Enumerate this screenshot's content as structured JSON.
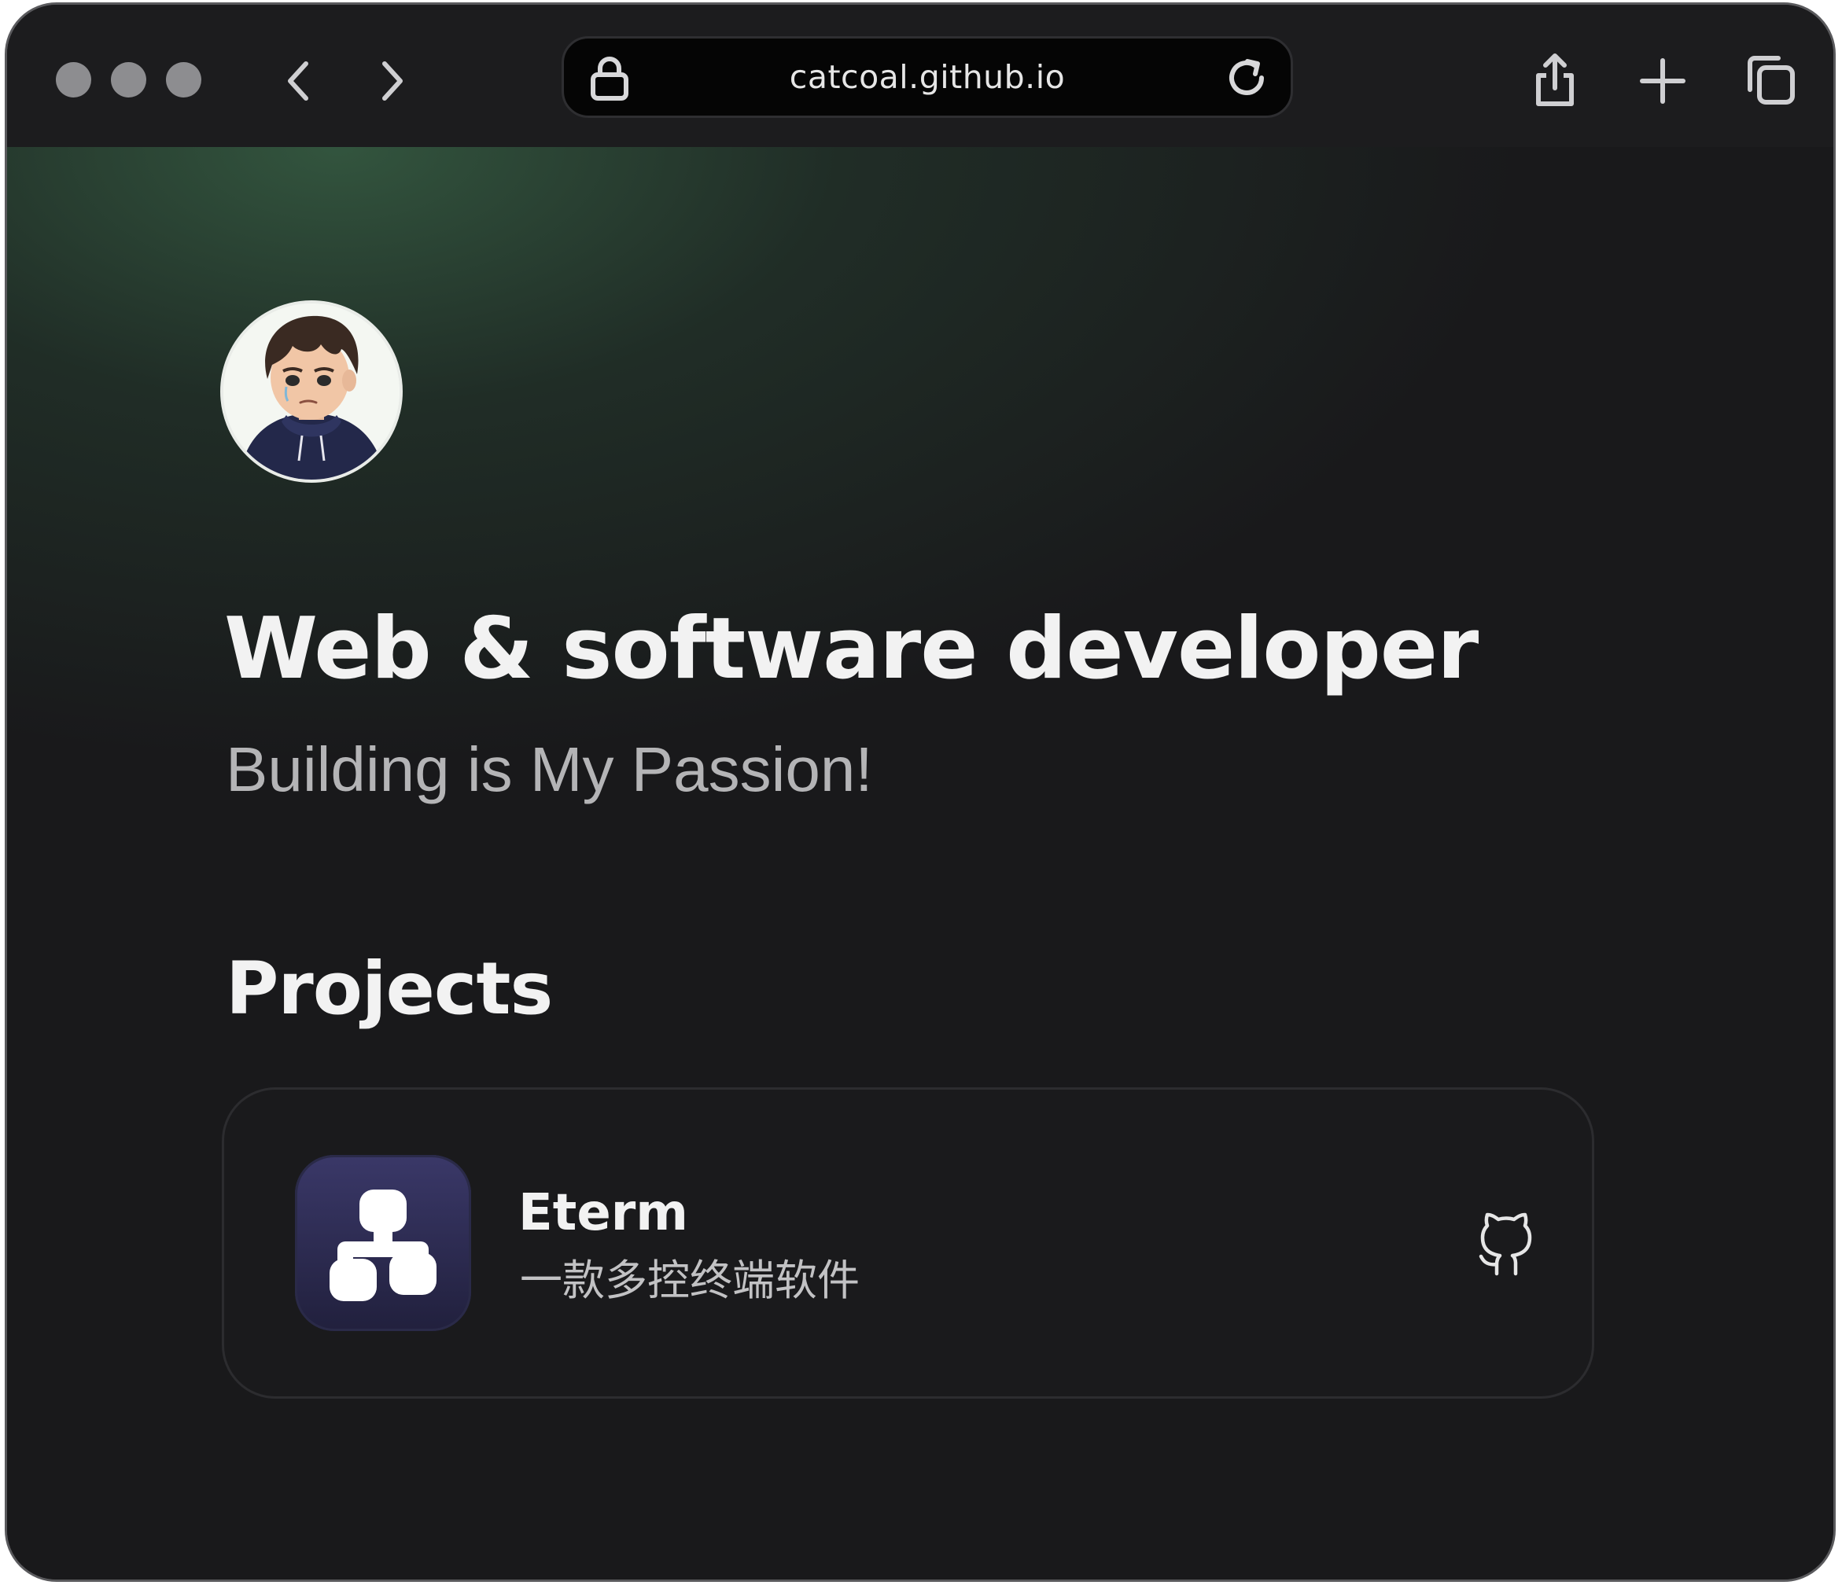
{
  "browser": {
    "url": "catcoal.github.io",
    "icons": {
      "back": "chevron-left-icon",
      "forward": "chevron-right-icon",
      "lock": "lock-icon",
      "reload": "reload-icon",
      "share": "share-icon",
      "new_tab": "plus-icon",
      "tabs": "tabs-overview-icon"
    }
  },
  "hero": {
    "headline": "Web & software developer",
    "tagline": "Building is My Passion!"
  },
  "projects": {
    "title": "Projects",
    "items": [
      {
        "name": "Eterm",
        "description": "一款多控终端软件",
        "icon": "network-hierarchy-icon",
        "link_icon": "github-icon"
      }
    ]
  },
  "colors": {
    "background": "#19191b",
    "accent_glow": "#2f4a38",
    "app_icon_bg": "#2e2c55"
  }
}
